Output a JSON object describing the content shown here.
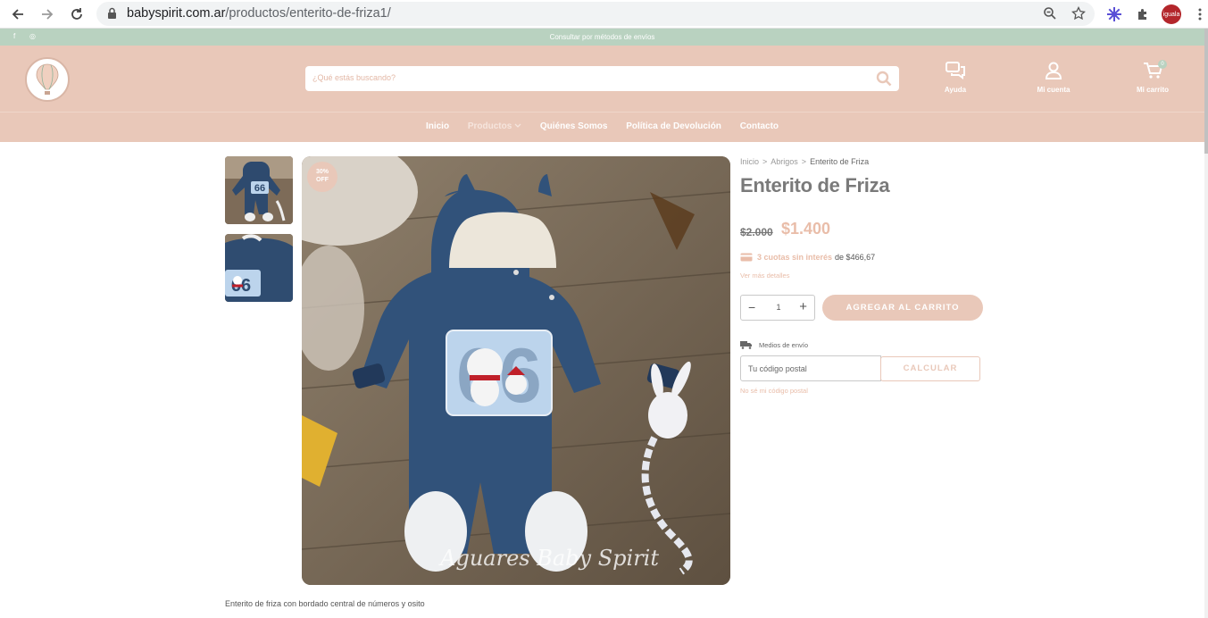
{
  "browser": {
    "url_host": "babyspirit.com.ar",
    "url_path": "/productos/enterito-de-friza1/",
    "profile_label": "iguala"
  },
  "topbar": {
    "social": [
      "f",
      "◎"
    ],
    "message": "Consultar por métodos de envíos"
  },
  "header": {
    "search_placeholder": "¿Qué estás buscando?",
    "help_label": "Ayuda",
    "account_label": "Mi cuenta",
    "cart_label": "Mi carrito",
    "cart_count": "0"
  },
  "menu": {
    "items": [
      "Inicio",
      "Productos",
      "Quiénes Somos",
      "Política de Devolución",
      "Contacto"
    ]
  },
  "product": {
    "sale_badge_top": "30%",
    "sale_badge_bottom": "OFF",
    "image_watermark": "Aguares Baby Spirit",
    "breadcrumb": [
      "Inicio",
      "Abrigos",
      "Enterito de Friza"
    ],
    "breadcrumb_separator": ">",
    "title": "Enterito de Friza",
    "old_price": "$2.000",
    "price": "$1.400",
    "installments_highlight": "3 cuotas sin interés",
    "installments_rest": "de $466,67",
    "more_details": "Ver más detalles",
    "quantity": "1",
    "add_to_cart": "AGREGAR AL CARRITO",
    "shipping_label": "Medios de envío",
    "postal_placeholder": "Tu código postal",
    "calculate": "CALCULAR",
    "postal_help": "No sé mi código postal",
    "description": "Enterito de friza con bordado central de números y osito"
  },
  "colors": {
    "topbar": "#b9d2c0",
    "header": "#e9c8b9",
    "accent": "#e9bda9"
  }
}
